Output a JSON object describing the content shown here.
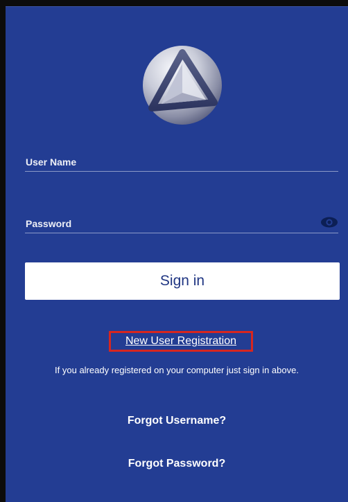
{
  "app": {
    "logo_icon": "triangle-sphere-logo"
  },
  "form": {
    "username_label": "User Name",
    "username_value": "",
    "password_label": "Password",
    "password_value": "",
    "password_toggle_icon": "eye-icon",
    "signin_label": "Sign in"
  },
  "links": {
    "new_user_registration": "New User Registration",
    "registration_highlight_color": "#d7261f",
    "info_text": "If you already registered on your computer just sign in above.",
    "forgot_username": "Forgot Username?",
    "forgot_password": "Forgot Password?"
  },
  "colors": {
    "background": "#233d93",
    "button": "#ffffff",
    "button_text": "#1f3582"
  }
}
